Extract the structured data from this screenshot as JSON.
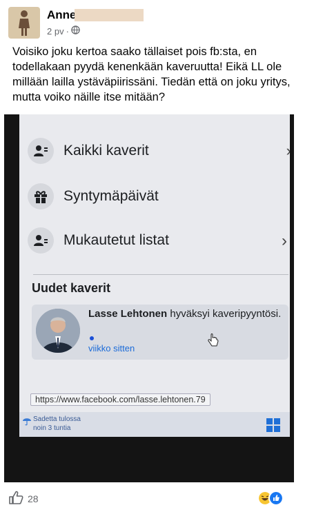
{
  "post": {
    "author": "Anne",
    "time": "2 pv",
    "separator": "·",
    "privacy_icon": "globe-icon",
    "text": "Voisiko joku kertoa saako tällaiset pois fb:sta, en todellakaan pyydä kenenkään kaveruutta! Eikä LL ole millään lailla ystäväpiirissäni. Tiedän että on joku yritys, mutta voiko näille itse mitään?"
  },
  "screenshot": {
    "menu": [
      {
        "label": "Kaikki kaverit",
        "icon": "friends-list-icon"
      },
      {
        "label": "Syntymäpäivät",
        "icon": "gift-icon"
      },
      {
        "label": "Mukautetut listat",
        "icon": "custom-list-icon"
      }
    ],
    "section_title": "Uudet kaverit",
    "notification": {
      "name": "Lasse Lehtonen",
      "action": " hyväksyi kaveripyyntösi.",
      "time": "viikko sitten"
    },
    "status_url": "https://www.facebook.com/lasse.lehtonen.79",
    "weather": {
      "line1": "Sadetta tulossa",
      "line2": "noin 3 tuntia"
    }
  },
  "footer": {
    "like_count": "28",
    "like_icon": "thumbs-up-icon"
  },
  "colors": {
    "link_blue": "#1b6bd8",
    "meta_gray": "#65676b"
  }
}
